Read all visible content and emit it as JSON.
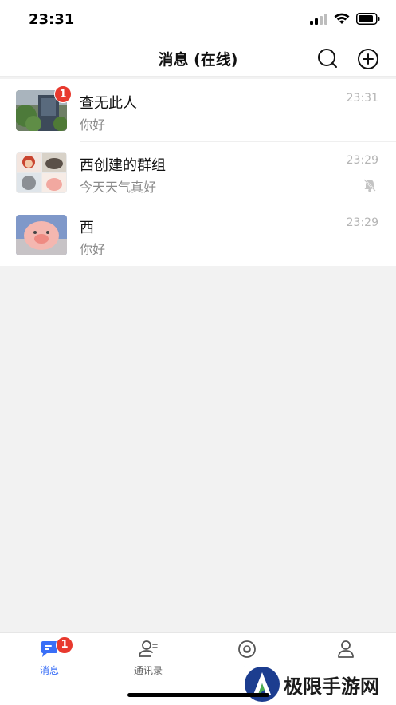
{
  "status_bar": {
    "time": "23:31"
  },
  "nav": {
    "title": "消息 (在线)"
  },
  "conversations": [
    {
      "name": "查无此人",
      "message": "你好",
      "time": "23:31",
      "unread": "1",
      "muted": false
    },
    {
      "name": "西创建的群组",
      "message": "今天天气真好",
      "time": "23:29",
      "unread": "",
      "muted": true
    },
    {
      "name": "西",
      "message": "你好",
      "time": "23:29",
      "unread": "",
      "muted": false
    }
  ],
  "tabs": [
    {
      "label": "消息",
      "icon": "chat-bubble-icon",
      "badge": "1",
      "active": true
    },
    {
      "label": "通讯录",
      "icon": "contacts-icon",
      "badge": "",
      "active": false
    },
    {
      "label": "生",
      "icon": "smile-icon",
      "badge": "",
      "active": false
    },
    {
      "label": "",
      "icon": "person-icon",
      "badge": "",
      "active": false
    }
  ],
  "watermark": {
    "text": "极限手游网"
  },
  "colors": {
    "accent": "#3a6ff7",
    "badge": "#e8392e",
    "background": "#f2f2f2"
  }
}
